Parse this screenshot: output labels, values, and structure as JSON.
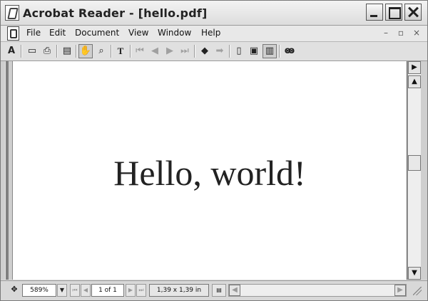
{
  "window": {
    "title": "Acrobat Reader - [hello.pdf]"
  },
  "menu": {
    "items": [
      "File",
      "Edit",
      "Document",
      "View",
      "Window",
      "Help"
    ]
  },
  "document": {
    "text": "Hello, world!"
  },
  "status": {
    "zoom": "589%",
    "page": "1 of 1",
    "page_size": "1,39 x 1,39 in"
  }
}
